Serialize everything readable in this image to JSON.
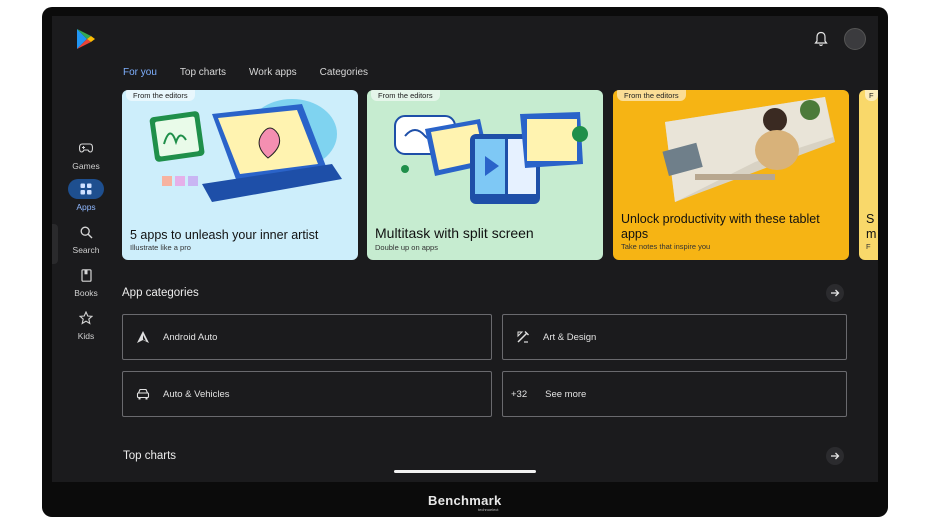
{
  "tabs": [
    {
      "label": "For you",
      "active": true
    },
    {
      "label": "Top charts",
      "active": false
    },
    {
      "label": "Work apps",
      "active": false
    },
    {
      "label": "Categories",
      "active": false
    }
  ],
  "nav": [
    {
      "label": "Games",
      "icon": "gamepad-icon",
      "selected": false
    },
    {
      "label": "Apps",
      "icon": "apps-grid-icon",
      "selected": true
    },
    {
      "label": "Search",
      "icon": "search-icon",
      "selected": false
    },
    {
      "label": "Books",
      "icon": "book-icon",
      "selected": false
    },
    {
      "label": "Kids",
      "icon": "star-icon",
      "selected": false
    }
  ],
  "cards": [
    {
      "badge": "From the editors",
      "title": "5 apps to unleash your inner artist",
      "subtitle": "Illustrate like a pro",
      "color": "#cdeefb"
    },
    {
      "badge": "From the editors",
      "title": "Multitask with split screen",
      "subtitle": "Double up on apps",
      "color": "#c6ecd0"
    },
    {
      "badge": "From the editors",
      "title": "Unlock productivity with these tablet apps",
      "subtitle": "Take notes that inspire you",
      "color": "#f6b414"
    },
    {
      "badge": "F",
      "title": "S m",
      "subtitle": "F",
      "color": "#f9d86a"
    }
  ],
  "app_categories": {
    "title": "App categories",
    "items": [
      {
        "label": "Android Auto",
        "icon": "android-auto-icon"
      },
      {
        "label": "Art & Design",
        "icon": "pen-ruler-icon"
      },
      {
        "label": "Auto & Vehicles",
        "icon": "car-icon"
      },
      {
        "count": "+32",
        "label": "See more"
      }
    ]
  },
  "top_charts": {
    "title": "Top charts"
  },
  "watermark": {
    "brand": "Benchmark",
    "tagline": "technoelect"
  },
  "colors": {
    "accent": "#7fb0ff",
    "selected_pill": "#1e4f8f",
    "background": "#1b1b1d"
  }
}
